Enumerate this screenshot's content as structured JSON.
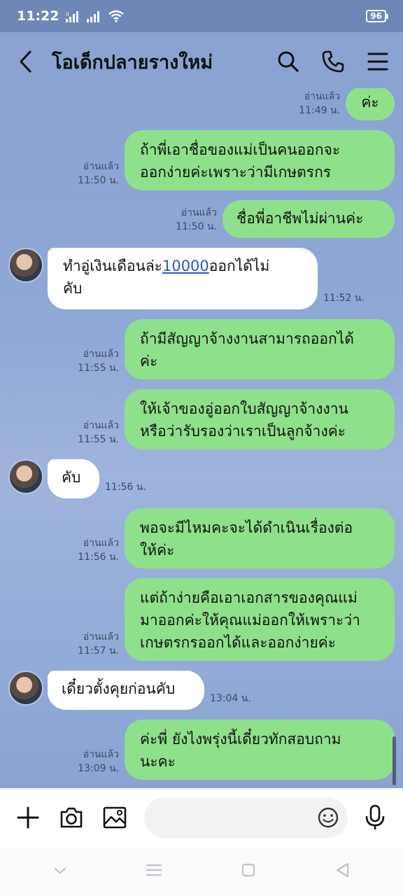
{
  "status_bar": {
    "time": "11:22",
    "battery": "96"
  },
  "header": {
    "title": "โอเด็กปลายรางใหม่"
  },
  "messages": [
    {
      "id": 0,
      "dir": "out",
      "text": "ค่ะ",
      "read": "อ่านแล้ว",
      "time": "11:49 น."
    },
    {
      "id": 1,
      "dir": "out",
      "text_lines": [
        "ถ้าพี่เอาชื่อของแม่เป็นคนออกจะ",
        "ออกง่ายค่ะเพราะว่ามีเกษตรกร"
      ],
      "read": "อ่านแล้ว",
      "time": "11:50 น."
    },
    {
      "id": 2,
      "dir": "out",
      "text": "ชื่อพี่อาชีพไม่ผ่านค่ะ",
      "read": "อ่านแล้ว",
      "time": "11:50 น."
    },
    {
      "id": 3,
      "dir": "in",
      "text_pre": "ทำอู่เงินเดือนล่ะ",
      "link": "10000",
      "text_post": "ออกได้ไม่",
      "text_line2": "คับ",
      "time": "11:52 น."
    },
    {
      "id": 4,
      "dir": "out",
      "text_lines": [
        "ถ้ามีสัญญาจ้างงานสามารถออกได้",
        "ค่ะ"
      ],
      "read": "อ่านแล้ว",
      "time": "11:55 น."
    },
    {
      "id": 5,
      "dir": "out",
      "text_lines": [
        "ให้เจ้าของอู่ออกใบสัญญาจ้างงาน",
        "หรือว่ารับรองว่าเราเป็นลูกจ้างค่ะ"
      ],
      "read": "อ่านแล้ว",
      "time": "11:55 น."
    },
    {
      "id": 6,
      "dir": "in",
      "text": "คับ",
      "time": "11:56 น."
    },
    {
      "id": 7,
      "dir": "out",
      "text_lines": [
        "พอจะมีไหมคะจะได้ดำเนินเรื่องต่อ",
        "ให้ค่ะ"
      ],
      "read": "อ่านแล้ว",
      "time": "11:56 น."
    },
    {
      "id": 8,
      "dir": "out",
      "text_lines": [
        "แต่ถ้าง่ายคือเอาเอกสารของคุณแม่",
        "มาออกค่ะให้คุณแม่ออกให้เพราะว่า",
        "เกษตรกรออกได้และออกง่ายค่ะ"
      ],
      "read": "อ่านแล้ว",
      "time": "11:57 น."
    },
    {
      "id": 9,
      "dir": "in",
      "text": "เดี๋ยวตั้งคุยก่อนคับ",
      "time": "13:04 น."
    },
    {
      "id": 10,
      "dir": "out",
      "text_lines": [
        "ค่ะพี่ ยังไงพรุ่งนี้เดี๋ยวทักสอบถาม",
        "นะคะ"
      ],
      "read": "อ่านแล้ว",
      "time": "13:09 น."
    }
  ],
  "icons": {
    "back": "chevron-left-icon",
    "search": "search-icon",
    "call": "phone-icon",
    "menu": "menu-icon",
    "plus": "plus-icon",
    "camera": "camera-icon",
    "image": "image-icon",
    "emoji": "emoji-icon",
    "mic": "mic-icon"
  },
  "colors": {
    "outgoing_bubble": "#8fe08a",
    "incoming_bubble": "#ffffff",
    "background": "#8aa3d2",
    "link": "#2a58c9"
  }
}
